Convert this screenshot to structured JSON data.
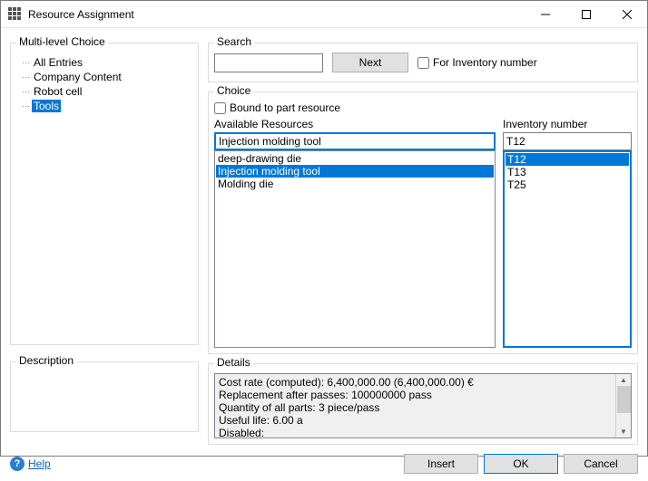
{
  "window": {
    "title": "Resource Assignment"
  },
  "left": {
    "multi_label": "Multi-level Choice",
    "tree": [
      {
        "label": "All Entries",
        "selected": false
      },
      {
        "label": "Company Content",
        "selected": false
      },
      {
        "label": "Robot cell",
        "selected": false
      },
      {
        "label": "Tools",
        "selected": true
      }
    ],
    "description_label": "Description"
  },
  "search": {
    "label": "Search",
    "value": "",
    "next_label": "Next",
    "inv_chk_label": "For Inventory number",
    "inv_chk_checked": false
  },
  "choice": {
    "label": "Choice",
    "bound_label": "Bound to part resource",
    "bound_checked": false,
    "avail_label": "Available Resources",
    "avail_value": "Injection molding tool",
    "avail_items": [
      {
        "label": "deep-drawing die",
        "selected": false
      },
      {
        "label": "Injection molding tool",
        "selected": true
      },
      {
        "label": "Molding die",
        "selected": false
      }
    ],
    "inv_label": "Inventory number",
    "inv_value": "T12",
    "inv_items": [
      {
        "label": "T12",
        "selected": true
      },
      {
        "label": "T13",
        "selected": false
      },
      {
        "label": "T25",
        "selected": false
      }
    ]
  },
  "details": {
    "label": "Details",
    "lines": [
      "Cost rate (computed): 6,400,000.00 (6,400,000.00) €",
      "Replacement after passes: 100000000 pass",
      "Quantity of all parts: 3 piece/pass",
      "Useful life: 6.00 a",
      "Disabled:"
    ]
  },
  "buttons": {
    "help": "Help",
    "insert": "Insert",
    "ok": "OK",
    "cancel": "Cancel"
  }
}
